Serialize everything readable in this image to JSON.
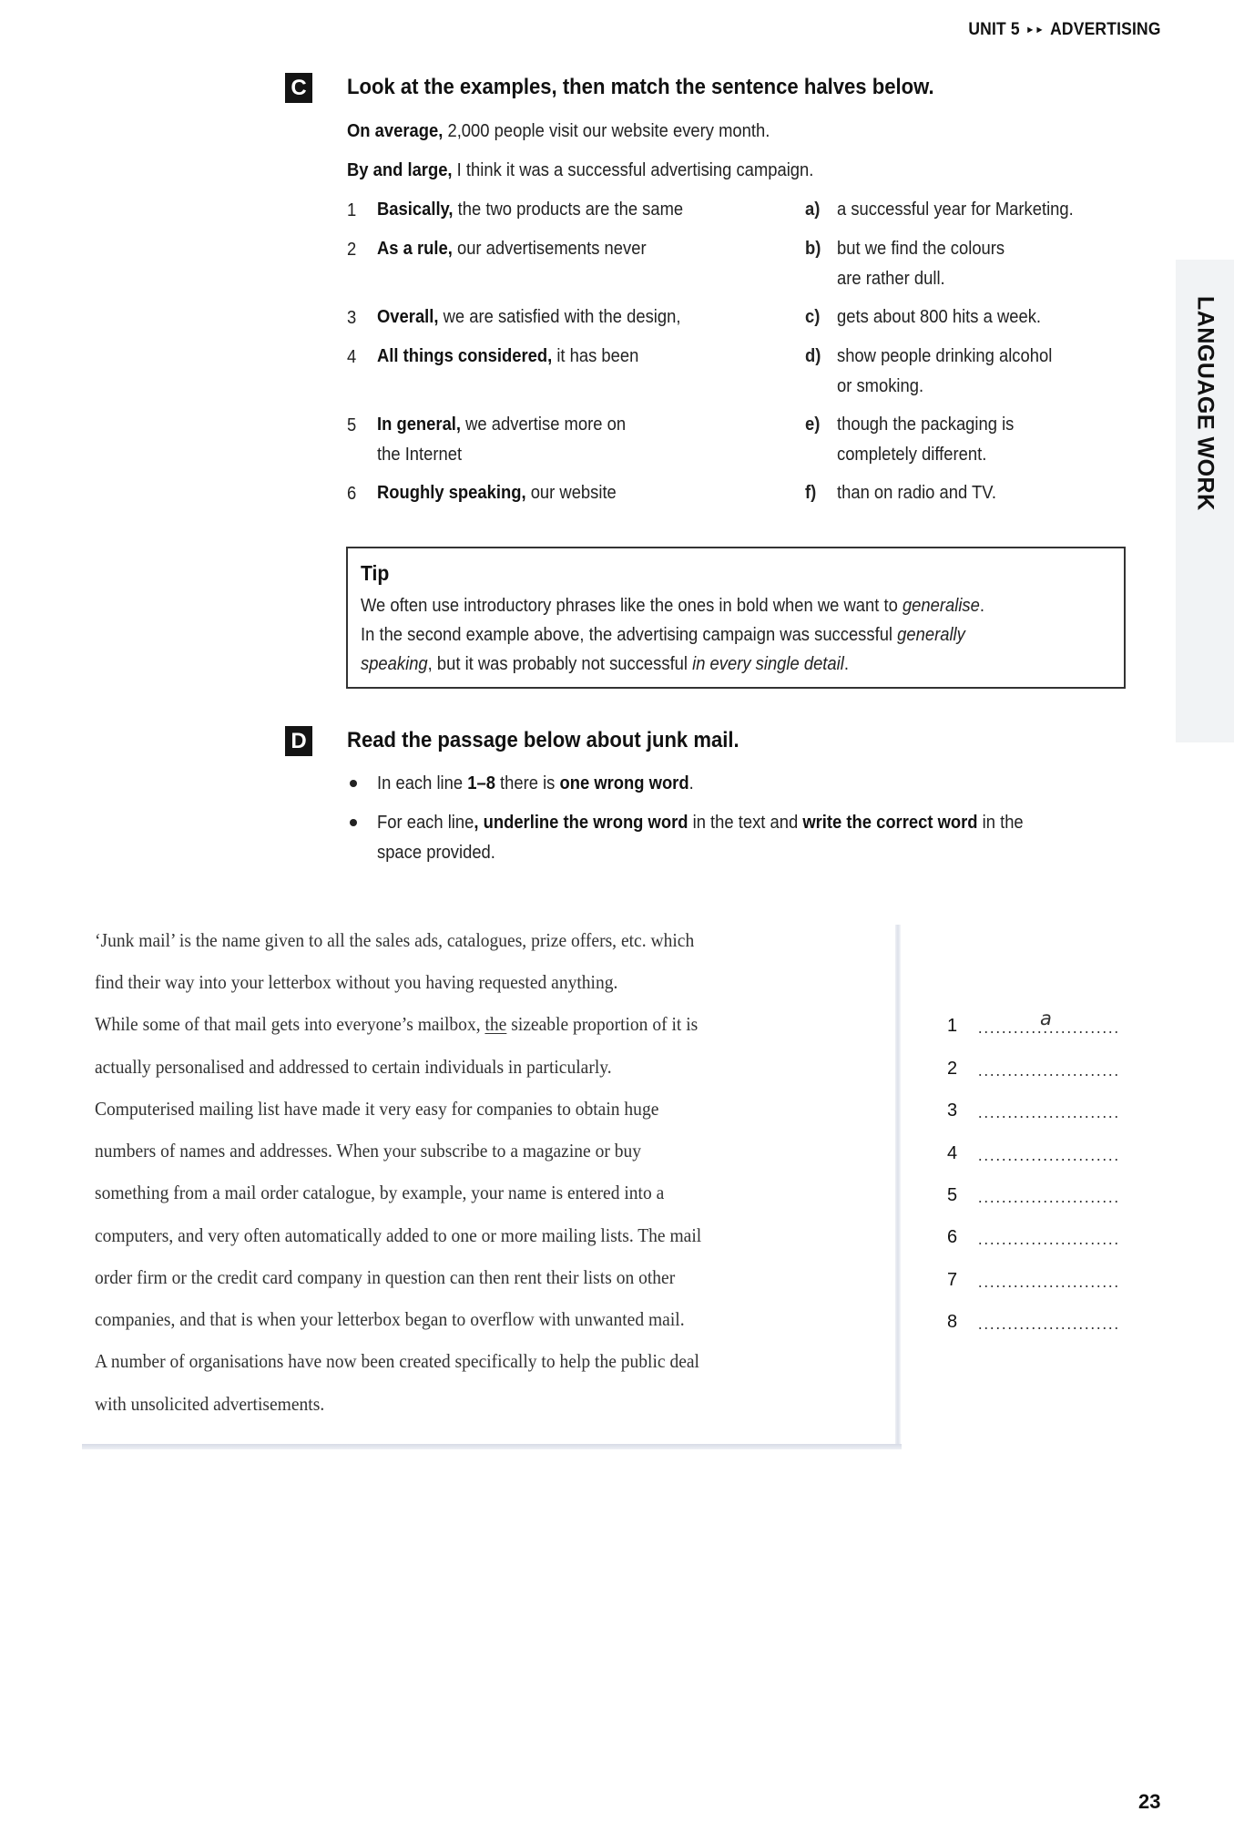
{
  "header": {
    "unit": "UNIT 5",
    "arrows": "►►",
    "topic": "ADVERTISING"
  },
  "side_tab": {
    "label": "LANGUAGE WORK"
  },
  "section_c": {
    "badge": "C",
    "title": "Look at the examples, then match the sentence halves below.",
    "examples": [
      {
        "bold": "On average,",
        "rest": " 2,000 people visit our website every month."
      },
      {
        "bold": "By and large,",
        "rest": " I think it was a successful advertising campaign."
      }
    ],
    "left_items": [
      {
        "num": "1",
        "bold": "Basically,",
        "rest": " the two products are the same",
        "line2": ""
      },
      {
        "num": "2",
        "bold": "As a rule,",
        "rest": " our advertisements never",
        "line2": ""
      },
      {
        "num": "3",
        "bold": "Overall,",
        "rest": " we are satisfied with the design,",
        "line2": ""
      },
      {
        "num": "4",
        "bold": "All things considered,",
        "rest": " it has been",
        "line2": ""
      },
      {
        "num": "5",
        "bold": "In general,",
        "rest": " we advertise more on",
        "line2": "the Internet"
      },
      {
        "num": "6",
        "bold": "Roughly speaking,",
        "rest": " our website",
        "line2": ""
      }
    ],
    "right_items": [
      {
        "letter": "a)",
        "line1": "a successful year for Marketing.",
        "line2": ""
      },
      {
        "letter": "b)",
        "line1": "but we find the colours",
        "line2": "are rather dull."
      },
      {
        "letter": "c)",
        "line1": "gets about 800 hits a week.",
        "line2": ""
      },
      {
        "letter": "d)",
        "line1": "show people drinking alcohol",
        "line2": "or smoking."
      },
      {
        "letter": "e)",
        "line1": "though the packaging is",
        "line2": "completely different."
      },
      {
        "letter": "f)",
        "line1": "than on radio and TV.",
        "line2": ""
      }
    ]
  },
  "tip": {
    "title": "Tip",
    "line1_text": "We often use introductory phrases like the ones in bold when we want to ",
    "line1_italic": "generalise",
    "line1_end": ".",
    "line2_text": "In the second example above, the advertising campaign was successful ",
    "line2_italic": "generally",
    "line3_italic": "speaking",
    "line3_text": ", but it was probably not successful ",
    "line3_italic2": "in every single detail",
    "line3_end": "."
  },
  "section_d": {
    "badge": "D",
    "title": "Read the passage below about junk mail.",
    "bullets": [
      {
        "t1": "In each line ",
        "b1": "1–8",
        "t2": " there is ",
        "b2": "one wrong word",
        "t3": ".",
        "b3": "",
        "t4": "",
        "line2": ""
      },
      {
        "t1": "For each line",
        "b1": ", underline the wrong word",
        "t2": " in the text and ",
        "b2": "write the correct word",
        "t3": " in the",
        "b3": "",
        "t4": "",
        "line2": "space provided."
      }
    ]
  },
  "passage": {
    "lines": [
      {
        "pre": "‘Junk mail’ is the name given to all the sales ads, catalogues, prize offers, etc. which",
        "underlined": "",
        "post": ""
      },
      {
        "pre": "find their way into your letterbox without you having requested anything.",
        "underlined": "",
        "post": ""
      },
      {
        "pre": "While some of that mail gets into everyone’s mailbox, ",
        "underlined": "the",
        "post": " sizeable proportion of it is"
      },
      {
        "pre": "actually personalised and addressed to certain individuals in particularly.",
        "underlined": "",
        "post": ""
      },
      {
        "pre": "Computerised mailing list have made it very easy for companies to obtain huge",
        "underlined": "",
        "post": ""
      },
      {
        "pre": "numbers of names and addresses. When your subscribe to a magazine or buy",
        "underlined": "",
        "post": ""
      },
      {
        "pre": "something from a mail order catalogue, by example, your name is entered into a",
        "underlined": "",
        "post": ""
      },
      {
        "pre": "computers, and very often automatically added to one or more mailing lists. The mail",
        "underlined": "",
        "post": ""
      },
      {
        "pre": "order firm or the credit card company in question can then rent their lists on other",
        "underlined": "",
        "post": ""
      },
      {
        "pre": "companies, and that is when your letterbox began to overflow with unwanted mail.",
        "underlined": "",
        "post": ""
      },
      {
        "pre": "A number of organisations have now been created specifically to help the public deal",
        "underlined": "",
        "post": ""
      },
      {
        "pre": "with unsolicited advertisements.",
        "underlined": "",
        "post": ""
      }
    ]
  },
  "answers": [
    {
      "num": "1",
      "value": "a"
    },
    {
      "num": "2",
      "value": ""
    },
    {
      "num": "3",
      "value": ""
    },
    {
      "num": "4",
      "value": ""
    },
    {
      "num": "5",
      "value": ""
    },
    {
      "num": "6",
      "value": ""
    },
    {
      "num": "7",
      "value": ""
    },
    {
      "num": "8",
      "value": ""
    }
  ],
  "page_number": "23"
}
